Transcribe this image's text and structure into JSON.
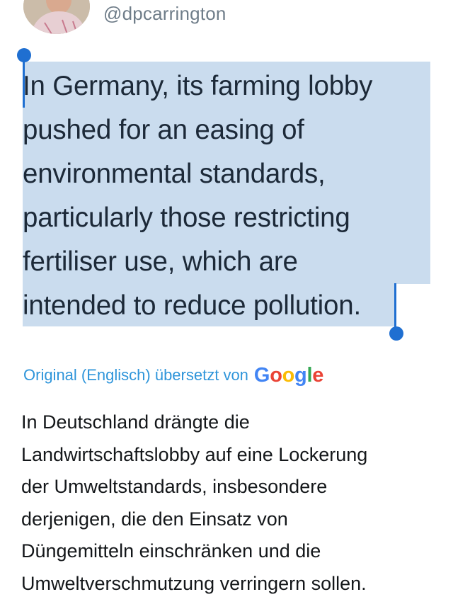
{
  "tweet": {
    "handle": "@dpcarrington",
    "text": "In Germany, its farming lobby\npushed for an easing of\nenvironmental standards,\nparticularly those restricting\nfertiliser use, which are\nintended to reduce pollution."
  },
  "translation": {
    "note": "Original (Englisch) übersetzt von",
    "provider_letters": [
      "G",
      "o",
      "o",
      "g",
      "l",
      "e"
    ],
    "text": "In Deutschland drängte die\nLandwirtschaftslobby auf eine Lockerung\nder Umweltstandards, insbesondere\nderjenigen, die den Einsatz von\nDüngemitteln einschränken und die\nUmweltverschmutzung verringern sollen."
  },
  "colors": {
    "selection": "#cadcee",
    "selection_handle": "#1f6fd1",
    "link": "#2f95da",
    "handle_text": "#6f7d89"
  },
  "icons": {
    "avatar": "profile-photo",
    "selection_start": "selection-start-handle",
    "selection_end": "selection-end-handle"
  }
}
